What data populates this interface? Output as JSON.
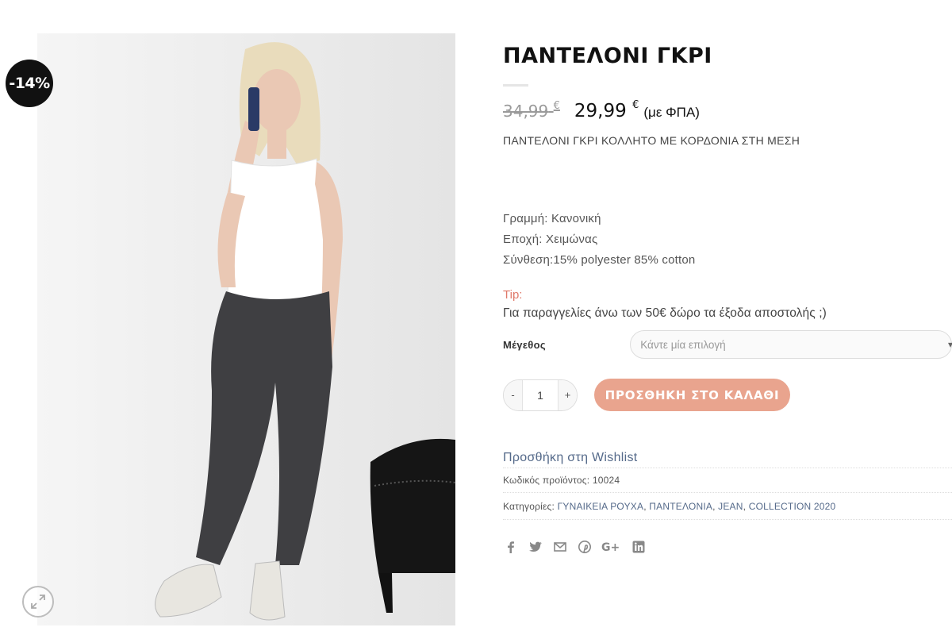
{
  "badge": {
    "discount": "-14%"
  },
  "product": {
    "title": "ΠΑΝΤΕΛΟΝΙ ΓΚΡΙ",
    "price_old": "34,99",
    "price_new": "29,99",
    "currency": "€",
    "vat_note": "(με ΦΠΑ)",
    "short_description": "ΠΑΝΤΕΛΟΝΙ ΓΚΡΙ ΚΟΛΛΗΤΟ ΜΕ ΚΟΡΔΟΝΙΑ ΣΤΗ ΜΕΣΗ",
    "attributes": [
      "Γραμμή: Κανονική",
      "Εποχή: Χειμώνας",
      "Σύνθεση:15% polyester 85% cotton"
    ],
    "tip_label": "Tip:",
    "tip_text": "Για παραγγελίες άνω των 50€ δώρο τα έξοδα αποστολής ;)"
  },
  "variation": {
    "label": "Μέγεθος",
    "placeholder": "Κάντε μία επιλογή"
  },
  "cart": {
    "minus": "-",
    "plus": "+",
    "quantity": "1",
    "add_label": "ΠΡΟΣΘΗΚΗ ΣΤΟ ΚΑΛΑΘΙ"
  },
  "wishlist_label": "Προσθήκη στη Wishlist",
  "meta": {
    "sku_label": "Κωδικός προϊόντος:",
    "sku": "10024",
    "categories_label": "Κατηγορίες:",
    "categories": [
      "ΓΥΝΑΙΚΕΙΑ ΡΟΥΧΑ",
      "ΠΑΝΤΕΛΟΝΙΑ",
      "JEAN",
      "COLLECTION 2020"
    ]
  },
  "share_icons": [
    "facebook-icon",
    "twitter-icon",
    "email-icon",
    "pinterest-icon",
    "google-plus-icon",
    "linkedin-icon"
  ],
  "colors": {
    "accent_button": "#e9a48e",
    "tip": "#e0796a",
    "link": "#556a8a",
    "badge": "#111111"
  }
}
